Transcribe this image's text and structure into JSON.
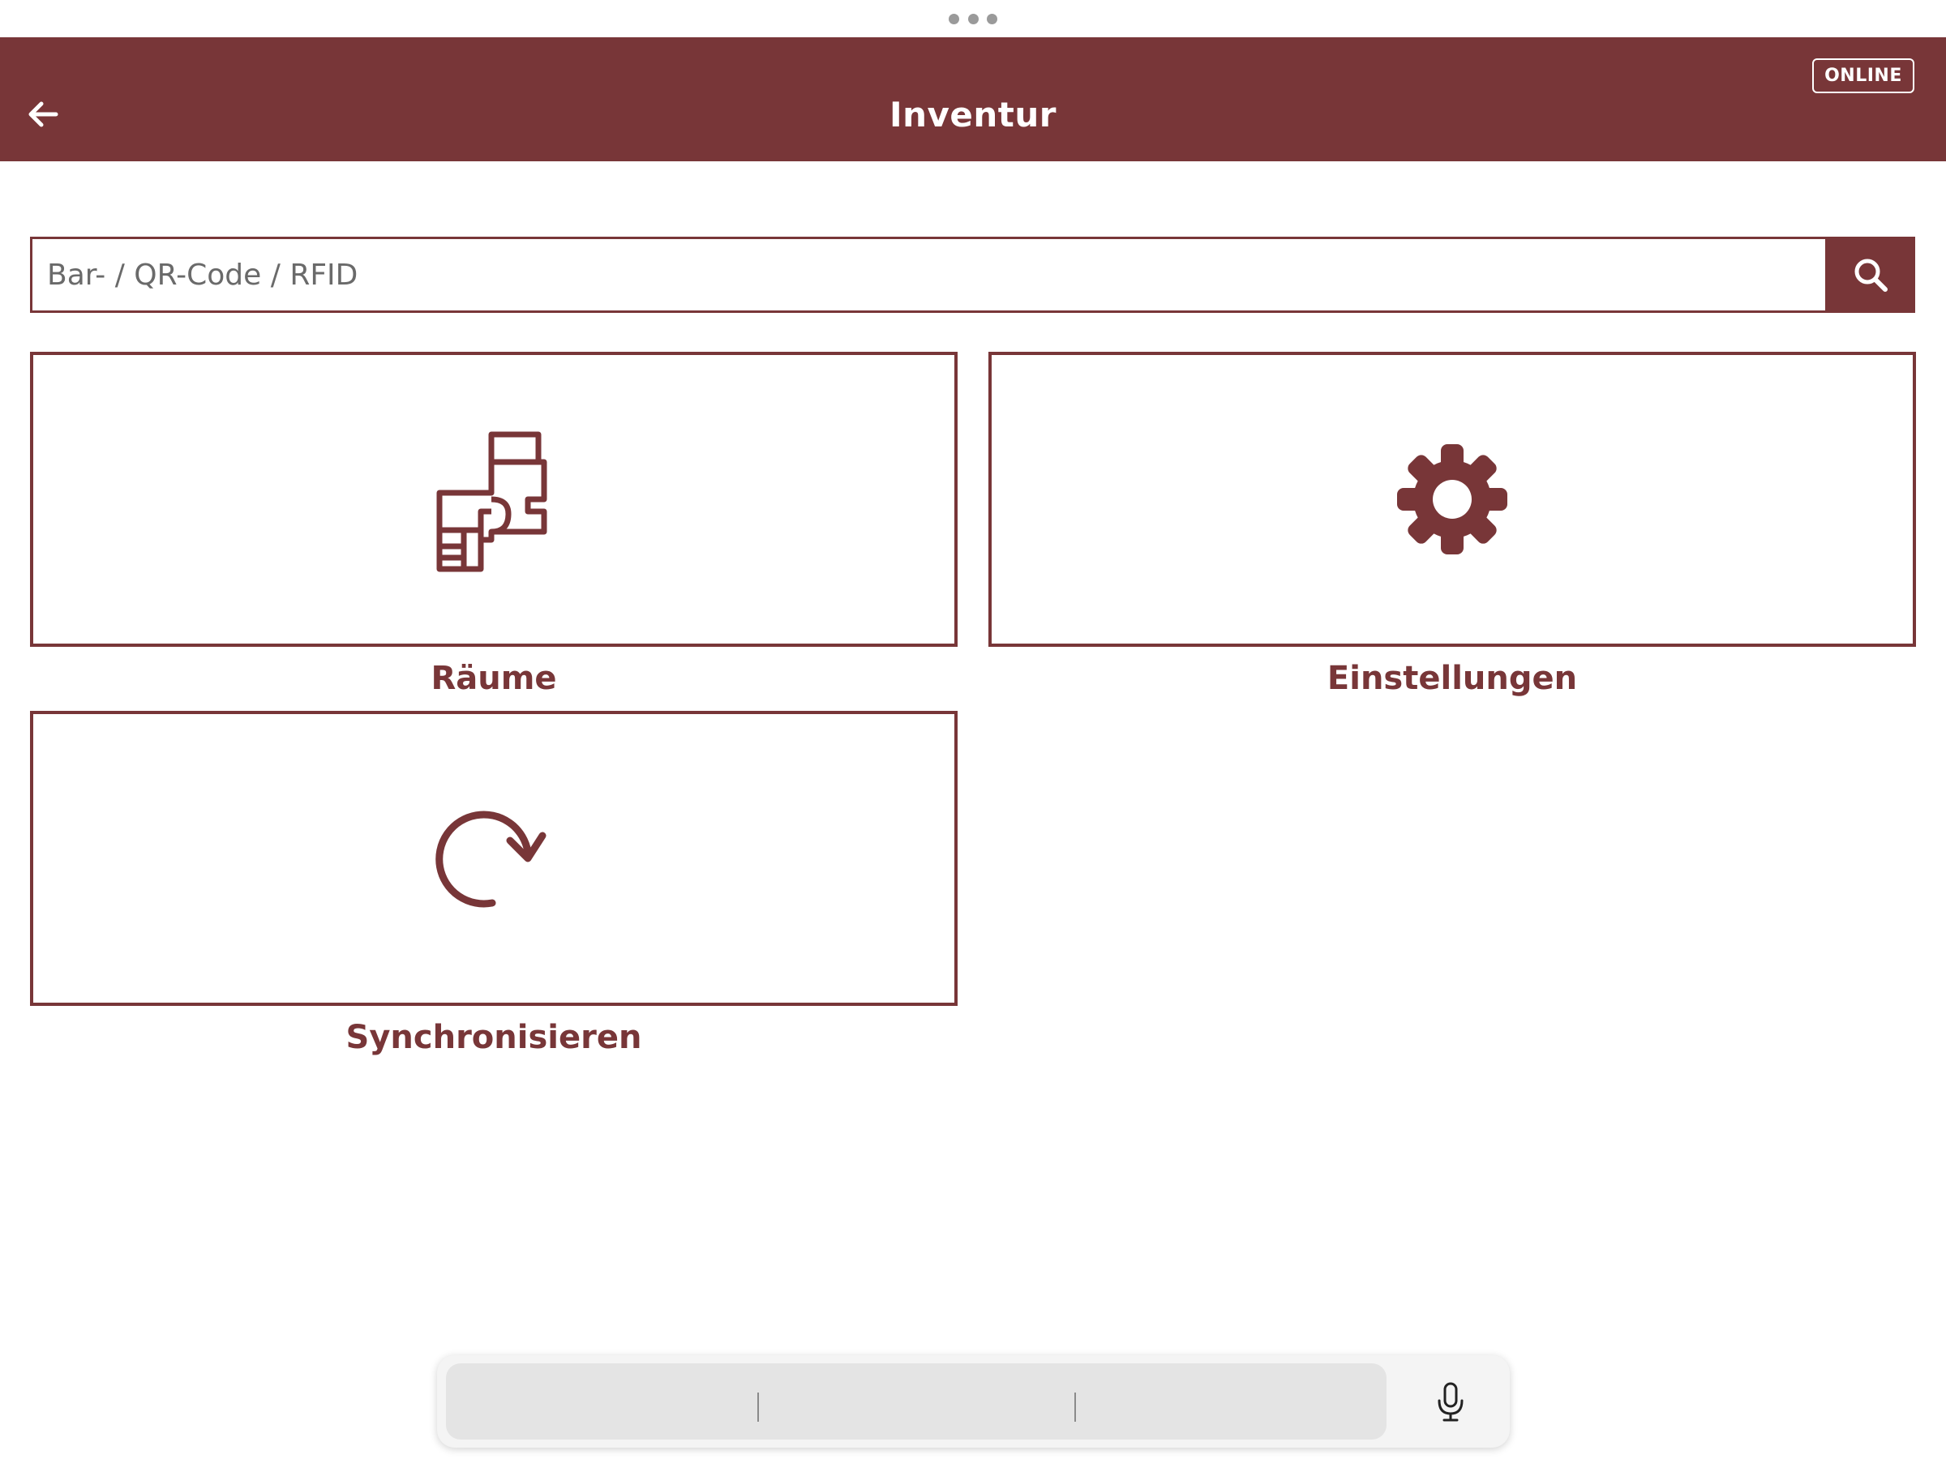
{
  "header": {
    "title": "Inventur",
    "status_badge": "ONLINE",
    "background_color": "#783638"
  },
  "search": {
    "placeholder": "Bar- / QR-Code / RFID",
    "value": "",
    "button_icon": "search-icon"
  },
  "tiles": [
    {
      "label": "Räume",
      "icon": "floor-plan-icon"
    },
    {
      "label": "Einstellungen",
      "icon": "gear-icon"
    },
    {
      "label": "Synchronisieren",
      "icon": "sync-icon"
    }
  ],
  "keyboard_toolbar": {
    "icon": "microphone-icon"
  },
  "colors": {
    "accent": "#783638"
  }
}
